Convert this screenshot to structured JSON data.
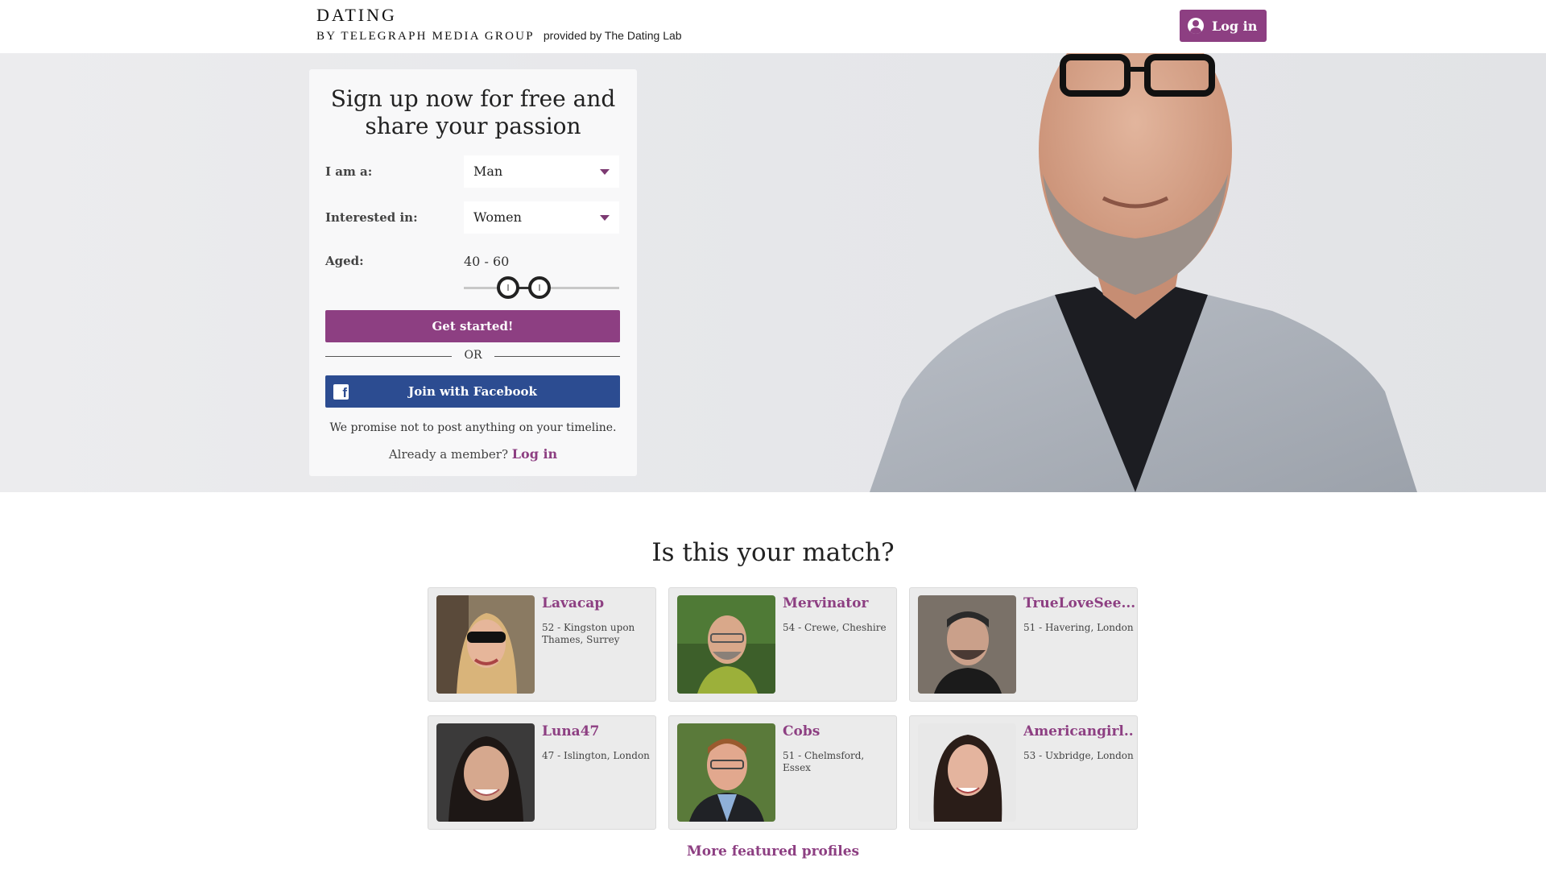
{
  "header": {
    "brand_title": "DATING",
    "brand_subtitle": "BY TELEGRAPH MEDIA GROUP",
    "brand_provided": "provided by The Dating Lab",
    "login_label": "Log in"
  },
  "signup": {
    "title_line1": "Sign up now for free and",
    "title_line2": "share your passion",
    "iam_label": "I am a:",
    "iam_value": "Man",
    "interested_label": "Interested in:",
    "interested_value": "Women",
    "aged_label": "Aged:",
    "age_range": "40 - 60",
    "age_min": 40,
    "age_max": 60,
    "start_label": "Get started!",
    "or_label": "OR",
    "facebook_label": "Join with Facebook",
    "promise_text": "We promise not to post anything on your timeline.",
    "already_text": "Already a member?",
    "already_link": "Log in"
  },
  "matches": {
    "title": "Is this your match?",
    "profiles": [
      {
        "name": "Lavacap",
        "info": "52 - Kingston upon Thames, Surrey"
      },
      {
        "name": "Mervinator",
        "info": "54 - Crewe, Cheshire"
      },
      {
        "name": "TrueLoveSee...",
        "info": "51 - Havering, London"
      },
      {
        "name": "Luna47",
        "info": "47 - Islington, London"
      },
      {
        "name": "Cobs",
        "info": "51 - Chelmsford, Essex"
      },
      {
        "name": "Americangirl...",
        "info": "53 - Uxbridge, London"
      }
    ],
    "more_label": "More featured profiles"
  },
  "colors": {
    "brand_purple": "#8d3f82",
    "facebook_blue": "#2c4c91"
  }
}
